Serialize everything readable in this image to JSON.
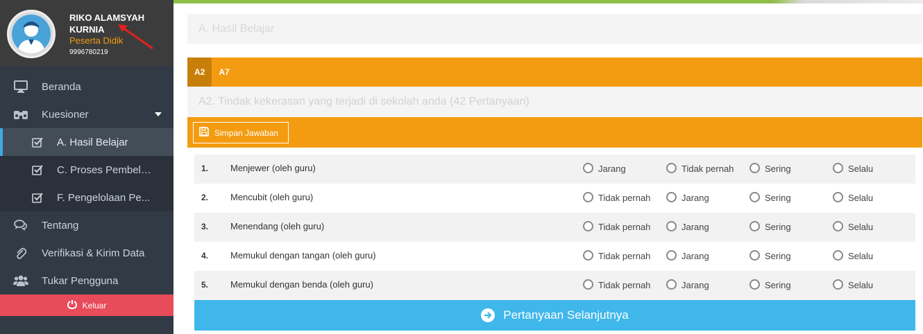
{
  "user": {
    "name": "RIKO ALAMSYAH KURNIA",
    "role": "Peserta Didik",
    "id": "9996780219",
    "avatar_icon": "user-avatar-icon"
  },
  "sidebar": {
    "items": [
      {
        "label": "Beranda",
        "icon": "monitor-icon"
      },
      {
        "label": "Kuesioner",
        "icon": "binoculars-icon"
      },
      {
        "label": "A. Hasil Belajar",
        "icon": "checkbox-icon"
      },
      {
        "label": "C. Proses Pembela...",
        "icon": "checkbox-icon"
      },
      {
        "label": "F. Pengelolaan Pe...",
        "icon": "checkbox-icon"
      },
      {
        "label": "Tentang",
        "icon": "comments-icon"
      },
      {
        "label": "Verifikasi & Kirim Data",
        "icon": "paperclip-icon"
      },
      {
        "label": "Tukar Pengguna",
        "icon": "users-icon"
      }
    ],
    "logout_label": "Keluar"
  },
  "main": {
    "section_title": "A. Hasil Belajar",
    "tabs": [
      {
        "label": "A2"
      },
      {
        "label": "A7"
      }
    ],
    "question_header": "A2. Tindak kekerasan yang terjadi di sekolah anda (42 Pertanyaan)",
    "save_label": "Simpan Jawaban",
    "questions": [
      {
        "num": "1.",
        "text": "Menjewer (oleh guru)",
        "options": [
          "Jarang",
          "Tidak pernah",
          "Sering",
          "Selalu"
        ]
      },
      {
        "num": "2.",
        "text": "Mencubit (oleh guru)",
        "options": [
          "Tidak pernah",
          "Jarang",
          "Sering",
          "Selalu"
        ]
      },
      {
        "num": "3.",
        "text": "Menendang (oleh guru)",
        "options": [
          "Tidak pernah",
          "Jarang",
          "Sering",
          "Selalu"
        ]
      },
      {
        "num": "4.",
        "text": "Memukul dengan tangan (oleh guru)",
        "options": [
          "Tidak pernah",
          "Jarang",
          "Sering",
          "Selalu"
        ]
      },
      {
        "num": "5.",
        "text": "Memukul dengan benda (oleh guru)",
        "options": [
          "Tidak pernah",
          "Jarang",
          "Sering",
          "Selalu"
        ]
      }
    ],
    "next_label": "Pertanyaan Selanjutnya"
  },
  "colors": {
    "sidebar_bg": "#313a45",
    "accent_orange": "#f39c12",
    "logout_red": "#e84b5a",
    "next_blue": "#3fb7ea",
    "role_orange": "#f39c12"
  }
}
